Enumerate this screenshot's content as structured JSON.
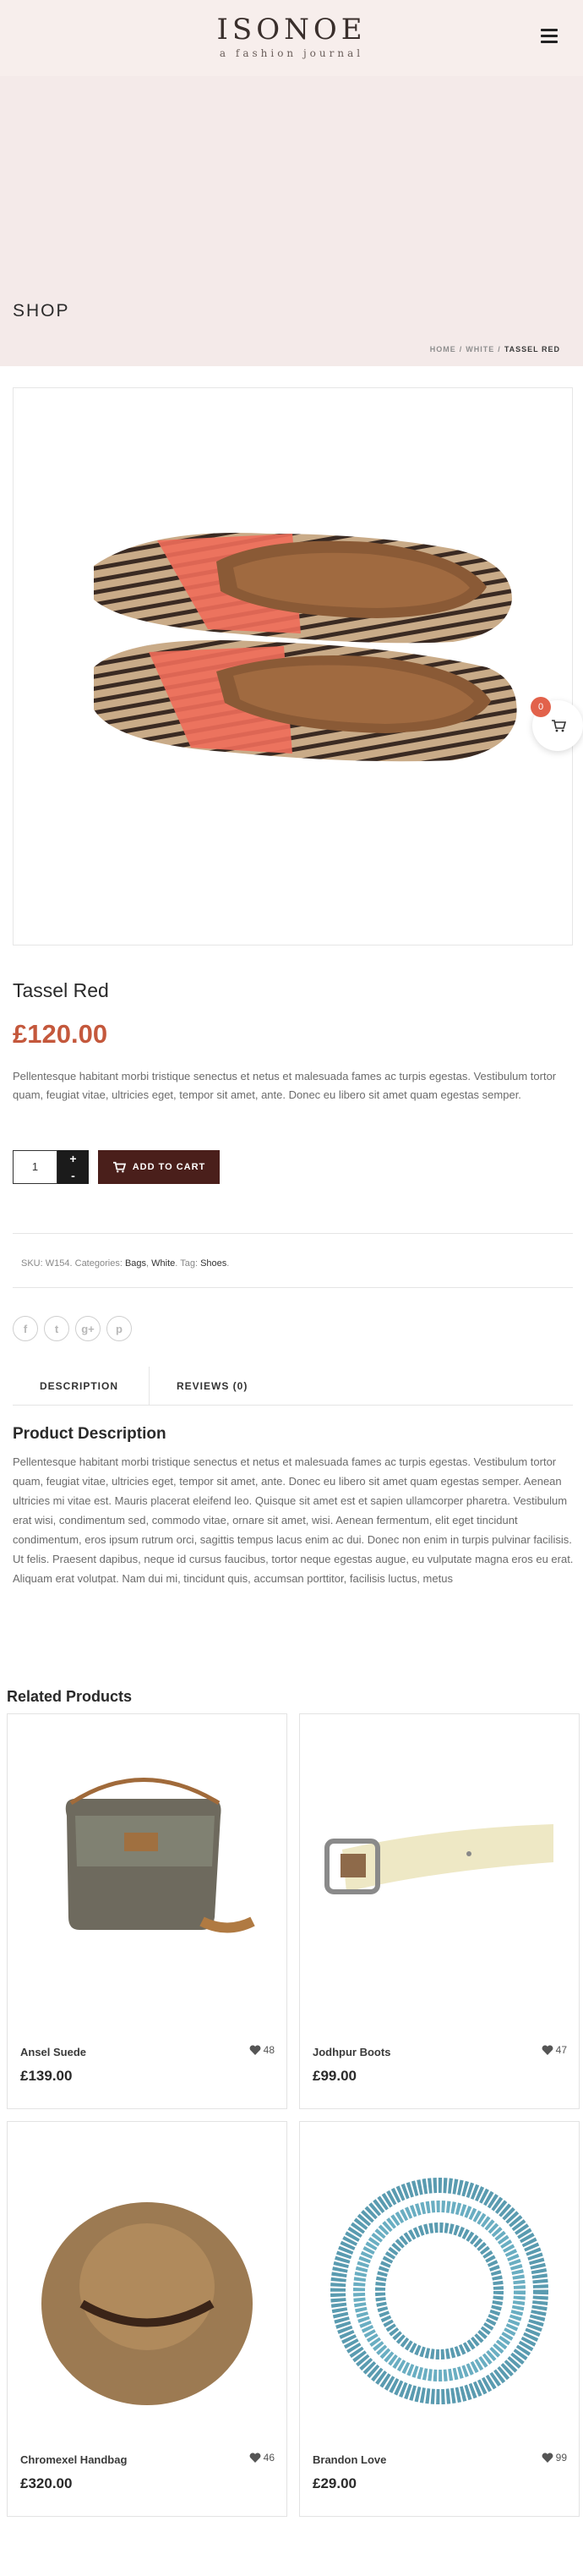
{
  "header": {
    "logo_title": "ISONOE",
    "logo_tagline": "a fashion journal",
    "menu_icon": "hamburger-icon"
  },
  "hero": {
    "title": "SHOP",
    "breadcrumb": [
      "HOME",
      "WHITE",
      "TASSEL RED"
    ]
  },
  "cart": {
    "count": "0",
    "icon": "cart-icon"
  },
  "product": {
    "title": "Tassel Red",
    "price": "£120.00",
    "short_description": "Pellentesque habitant morbi tristique senectus et netus et malesuada fames ac turpis egestas. Vestibulum tortor quam, feugiat vitae, ultricies eget, tempor sit amet, ante. Donec eu libero sit amet quam egestas semper.",
    "quantity": "1",
    "qty_plus": "+",
    "qty_minus": "-",
    "add_to_cart": "ADD TO CART",
    "sku_label": "SKU:",
    "sku": "W154",
    "categories_label": "Categories:",
    "categories": [
      "Bags",
      "White"
    ],
    "tag_label": "Tag:",
    "tag": "Shoes",
    "share": [
      {
        "name": "facebook-icon",
        "glyph": "f"
      },
      {
        "name": "twitter-icon",
        "glyph": "t"
      },
      {
        "name": "google-plus-icon",
        "glyph": "g+"
      },
      {
        "name": "pinterest-icon",
        "glyph": "p"
      }
    ]
  },
  "tabs": [
    "DESCRIPTION",
    "REVIEWS (0)"
  ],
  "description": {
    "title": "Product Description",
    "body": "Pellentesque habitant morbi tristique senectus et netus et malesuada fames ac turpis egestas. Vestibulum tortor quam, feugiat vitae, ultricies eget, tempor sit amet, ante. Donec eu libero sit amet quam egestas semper. Aenean ultricies mi vitae est. Mauris placerat eleifend leo. Quisque sit amet est et sapien ullamcorper pharetra. Vestibulum erat wisi, condimentum sed, commodo vitae, ornare sit amet, wisi. Aenean fermentum, elit eget tincidunt condimentum, eros ipsum rutrum orci, sagittis tempus lacus enim ac dui. Donec non enim in turpis pulvinar facilisis. Ut felis. Praesent dapibus, neque id cursus faucibus, tortor neque egestas augue, eu vulputate magna eros eu erat. Aliquam erat volutpat. Nam dui mi, tincidunt quis, accumsan porttitor, facilisis luctus, metus"
  },
  "related": {
    "title": "Related Products",
    "items": [
      {
        "name": "Ansel Suede",
        "price": "£139.00",
        "likes": "48"
      },
      {
        "name": "Jodhpur Boots",
        "price": "£99.00",
        "likes": "47"
      },
      {
        "name": "Chromexel Handbag",
        "price": "£320.00",
        "likes": "46"
      },
      {
        "name": "Brandon Love",
        "price": "£29.00",
        "likes": "99"
      }
    ]
  },
  "colors": {
    "header_bg": "#f7eeec",
    "accent_price": "#c4583c",
    "button_bg": "#4a1f1b",
    "cart_badge": "#e2624b"
  }
}
